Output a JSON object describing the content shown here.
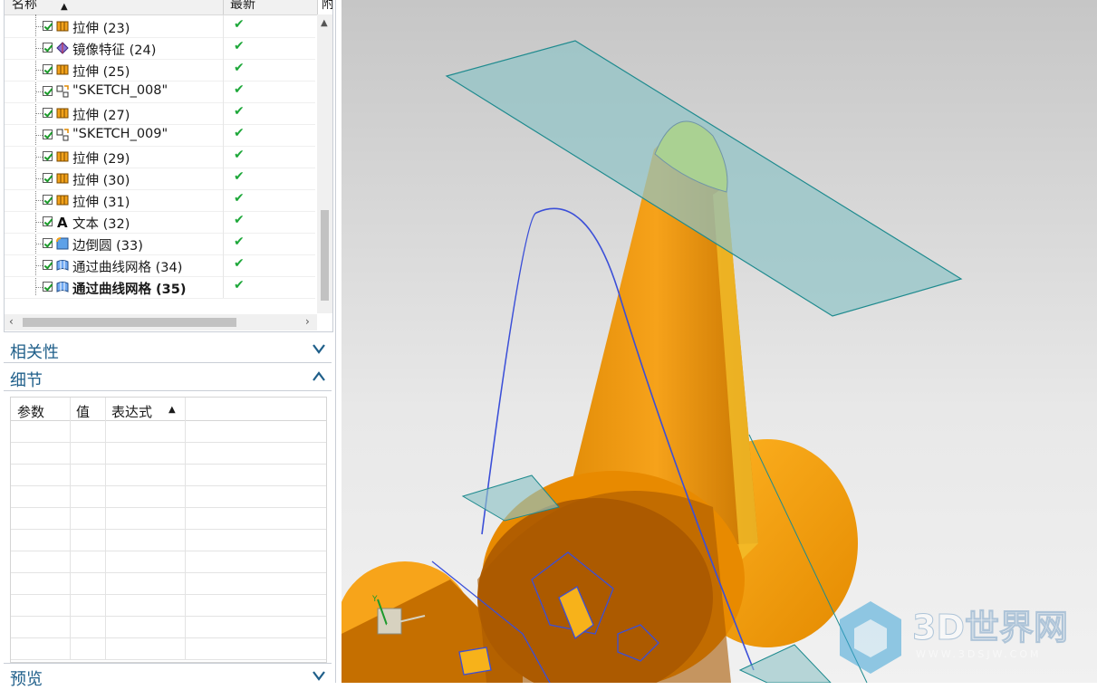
{
  "tree": {
    "headers": {
      "name": "名称",
      "latest": "最新",
      "extra": "附"
    },
    "rows": [
      {
        "label": "拉伸 (23)",
        "icon": "extrude-icon",
        "bold": false
      },
      {
        "label": "镜像特征 (24)",
        "icon": "mirror-feature-icon",
        "bold": false
      },
      {
        "label": "拉伸 (25)",
        "icon": "extrude-icon",
        "bold": false
      },
      {
        "label": "\"SKETCH_008\"",
        "icon": "sketch-icon",
        "bold": false
      },
      {
        "label": "拉伸 (27)",
        "icon": "extrude-icon",
        "bold": false
      },
      {
        "label": "\"SKETCH_009\"",
        "icon": "sketch-icon",
        "bold": false
      },
      {
        "label": "拉伸 (29)",
        "icon": "extrude-icon",
        "bold": false
      },
      {
        "label": "拉伸 (30)",
        "icon": "extrude-icon",
        "bold": false
      },
      {
        "label": "拉伸 (31)",
        "icon": "extrude-icon",
        "bold": false
      },
      {
        "label": "文本 (32)",
        "icon": "text-feature-icon",
        "bold": false
      },
      {
        "label": "边倒圆 (33)",
        "icon": "edge-blend-icon",
        "bold": false
      },
      {
        "label": "通过曲线网格 (34)",
        "icon": "through-curve-mesh-icon",
        "bold": false
      },
      {
        "label": "通过曲线网格 (35)",
        "icon": "through-curve-mesh-icon",
        "bold": true
      }
    ],
    "status_mark": "✔"
  },
  "panels": {
    "dependencies": "相关性",
    "details": "细节",
    "preview": "预览"
  },
  "details_table": {
    "columns": [
      "参数",
      "值",
      "表达式"
    ]
  },
  "colors": {
    "accent": "#1f5f8a",
    "part_orange": "#f2a10f",
    "plane_teal": "#8fc3c6",
    "sketch_blue": "#3b4fd8"
  },
  "watermark": {
    "brand": "3D世界网",
    "url": "WWW.3DSJW.COM"
  }
}
